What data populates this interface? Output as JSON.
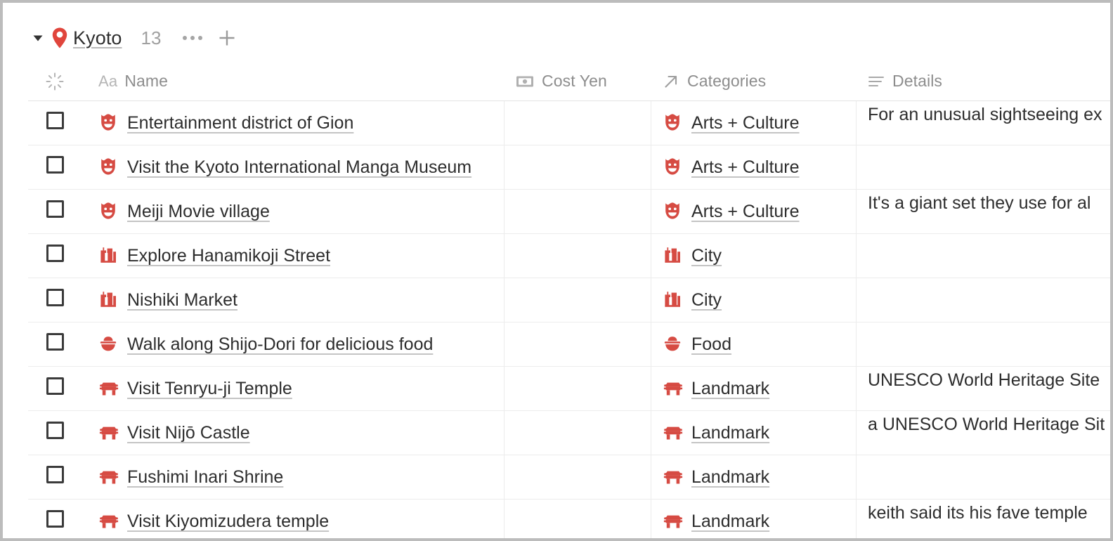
{
  "collection": {
    "title": "Kyoto",
    "count": "13",
    "pin_icon": "location-pin-icon",
    "caret_icon": "caret-down-icon",
    "more_label": "...",
    "add_label": "+",
    "accent": "#d64b43"
  },
  "table": {
    "columns": [
      {
        "key": "check",
        "label": "",
        "icon": "sparkle-loading-icon"
      },
      {
        "key": "name",
        "label": "Name",
        "icon": "text-aa-icon"
      },
      {
        "key": "cost",
        "label": "Cost Yen",
        "icon": "money-icon"
      },
      {
        "key": "categories",
        "label": "Categories",
        "icon": "relation-arrow-icon"
      },
      {
        "key": "details",
        "label": "Details",
        "icon": "text-lines-icon"
      }
    ],
    "rows": [
      {
        "name": "Entertainment district of Gion",
        "name_icon": "theater-mask-icon",
        "cost": "",
        "category": "Arts + Culture",
        "category_icon": "theater-mask-icon",
        "details": "For an unusual sightseeing ex"
      },
      {
        "name": "Visit the Kyoto International Manga Museum",
        "name_icon": "theater-mask-icon",
        "cost": "",
        "category": "Arts + Culture",
        "category_icon": "theater-mask-icon",
        "details": ""
      },
      {
        "name": "Meiji Movie village",
        "name_icon": "theater-mask-icon",
        "cost": "",
        "category": "Arts + Culture",
        "category_icon": "theater-mask-icon",
        "details": "It's a giant set they use for al"
      },
      {
        "name": "Explore Hanamikoji Street",
        "name_icon": "cityscape-icon",
        "cost": "",
        "category": "City",
        "category_icon": "cityscape-icon",
        "details": ""
      },
      {
        "name": "Nishiki Market",
        "name_icon": "cityscape-icon",
        "cost": "",
        "category": "City",
        "category_icon": "cityscape-icon",
        "details": ""
      },
      {
        "name": "Walk along Shijo-Dori for delicious food",
        "name_icon": "rice-bowl-icon",
        "cost": "",
        "category": "Food",
        "category_icon": "rice-bowl-icon",
        "details": ""
      },
      {
        "name": "Visit Tenryu-ji Temple",
        "name_icon": "shrine-icon",
        "cost": "",
        "category": "Landmark",
        "category_icon": "shrine-icon",
        "details": "UNESCO World Heritage Site"
      },
      {
        "name": "Visit Nijō Castle",
        "name_icon": "shrine-icon",
        "cost": "",
        "category": "Landmark",
        "category_icon": "shrine-icon",
        "details": "a UNESCO World Heritage Sit"
      },
      {
        "name": "Fushimi Inari Shrine",
        "name_icon": "shrine-icon",
        "cost": "",
        "category": "Landmark",
        "category_icon": "shrine-icon",
        "details": ""
      },
      {
        "name": "Visit Kiyomizudera temple",
        "name_icon": "shrine-icon",
        "cost": "",
        "category": "Landmark",
        "category_icon": "shrine-icon",
        "details": "keith said its his fave temple "
      }
    ]
  }
}
